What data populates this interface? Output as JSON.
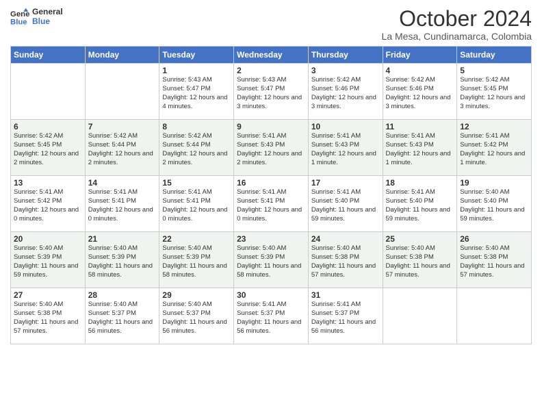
{
  "header": {
    "logo_line1": "General",
    "logo_line2": "Blue",
    "month_title": "October 2024",
    "location": "La Mesa, Cundinamarca, Colombia"
  },
  "weekdays": [
    "Sunday",
    "Monday",
    "Tuesday",
    "Wednesday",
    "Thursday",
    "Friday",
    "Saturday"
  ],
  "weeks": [
    [
      {
        "day": "",
        "info": ""
      },
      {
        "day": "",
        "info": ""
      },
      {
        "day": "1",
        "info": "Sunrise: 5:43 AM\nSunset: 5:47 PM\nDaylight: 12 hours and 4 minutes."
      },
      {
        "day": "2",
        "info": "Sunrise: 5:43 AM\nSunset: 5:47 PM\nDaylight: 12 hours and 3 minutes."
      },
      {
        "day": "3",
        "info": "Sunrise: 5:42 AM\nSunset: 5:46 PM\nDaylight: 12 hours and 3 minutes."
      },
      {
        "day": "4",
        "info": "Sunrise: 5:42 AM\nSunset: 5:46 PM\nDaylight: 12 hours and 3 minutes."
      },
      {
        "day": "5",
        "info": "Sunrise: 5:42 AM\nSunset: 5:45 PM\nDaylight: 12 hours and 3 minutes."
      }
    ],
    [
      {
        "day": "6",
        "info": "Sunrise: 5:42 AM\nSunset: 5:45 PM\nDaylight: 12 hours and 2 minutes."
      },
      {
        "day": "7",
        "info": "Sunrise: 5:42 AM\nSunset: 5:44 PM\nDaylight: 12 hours and 2 minutes."
      },
      {
        "day": "8",
        "info": "Sunrise: 5:42 AM\nSunset: 5:44 PM\nDaylight: 12 hours and 2 minutes."
      },
      {
        "day": "9",
        "info": "Sunrise: 5:41 AM\nSunset: 5:43 PM\nDaylight: 12 hours and 2 minutes."
      },
      {
        "day": "10",
        "info": "Sunrise: 5:41 AM\nSunset: 5:43 PM\nDaylight: 12 hours and 1 minute."
      },
      {
        "day": "11",
        "info": "Sunrise: 5:41 AM\nSunset: 5:43 PM\nDaylight: 12 hours and 1 minute."
      },
      {
        "day": "12",
        "info": "Sunrise: 5:41 AM\nSunset: 5:42 PM\nDaylight: 12 hours and 1 minute."
      }
    ],
    [
      {
        "day": "13",
        "info": "Sunrise: 5:41 AM\nSunset: 5:42 PM\nDaylight: 12 hours and 0 minutes."
      },
      {
        "day": "14",
        "info": "Sunrise: 5:41 AM\nSunset: 5:41 PM\nDaylight: 12 hours and 0 minutes."
      },
      {
        "day": "15",
        "info": "Sunrise: 5:41 AM\nSunset: 5:41 PM\nDaylight: 12 hours and 0 minutes."
      },
      {
        "day": "16",
        "info": "Sunrise: 5:41 AM\nSunset: 5:41 PM\nDaylight: 12 hours and 0 minutes."
      },
      {
        "day": "17",
        "info": "Sunrise: 5:41 AM\nSunset: 5:40 PM\nDaylight: 11 hours and 59 minutes."
      },
      {
        "day": "18",
        "info": "Sunrise: 5:41 AM\nSunset: 5:40 PM\nDaylight: 11 hours and 59 minutes."
      },
      {
        "day": "19",
        "info": "Sunrise: 5:40 AM\nSunset: 5:40 PM\nDaylight: 11 hours and 59 minutes."
      }
    ],
    [
      {
        "day": "20",
        "info": "Sunrise: 5:40 AM\nSunset: 5:39 PM\nDaylight: 11 hours and 59 minutes."
      },
      {
        "day": "21",
        "info": "Sunrise: 5:40 AM\nSunset: 5:39 PM\nDaylight: 11 hours and 58 minutes."
      },
      {
        "day": "22",
        "info": "Sunrise: 5:40 AM\nSunset: 5:39 PM\nDaylight: 11 hours and 58 minutes."
      },
      {
        "day": "23",
        "info": "Sunrise: 5:40 AM\nSunset: 5:39 PM\nDaylight: 11 hours and 58 minutes."
      },
      {
        "day": "24",
        "info": "Sunrise: 5:40 AM\nSunset: 5:38 PM\nDaylight: 11 hours and 57 minutes."
      },
      {
        "day": "25",
        "info": "Sunrise: 5:40 AM\nSunset: 5:38 PM\nDaylight: 11 hours and 57 minutes."
      },
      {
        "day": "26",
        "info": "Sunrise: 5:40 AM\nSunset: 5:38 PM\nDaylight: 11 hours and 57 minutes."
      }
    ],
    [
      {
        "day": "27",
        "info": "Sunrise: 5:40 AM\nSunset: 5:38 PM\nDaylight: 11 hours and 57 minutes."
      },
      {
        "day": "28",
        "info": "Sunrise: 5:40 AM\nSunset: 5:37 PM\nDaylight: 11 hours and 56 minutes."
      },
      {
        "day": "29",
        "info": "Sunrise: 5:40 AM\nSunset: 5:37 PM\nDaylight: 11 hours and 56 minutes."
      },
      {
        "day": "30",
        "info": "Sunrise: 5:41 AM\nSunset: 5:37 PM\nDaylight: 11 hours and 56 minutes."
      },
      {
        "day": "31",
        "info": "Sunrise: 5:41 AM\nSunset: 5:37 PM\nDaylight: 11 hours and 56 minutes."
      },
      {
        "day": "",
        "info": ""
      },
      {
        "day": "",
        "info": ""
      }
    ]
  ]
}
